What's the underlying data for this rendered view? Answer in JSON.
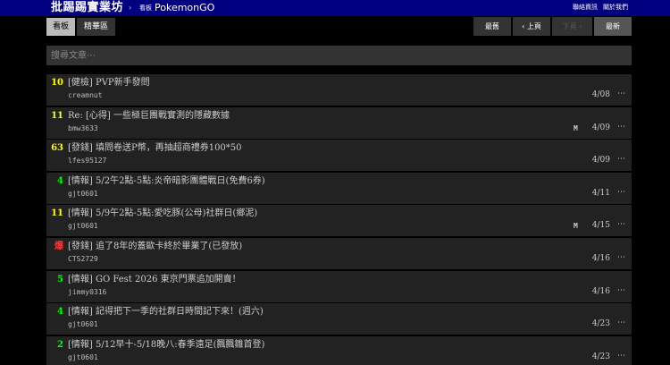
{
  "header": {
    "site_title": "批踢踢實業坊",
    "separator": "›",
    "board_label": "看板",
    "board_name": "PokemonGO",
    "links": [
      "聯絡資訊",
      "關於我們"
    ]
  },
  "tabs": [
    "看板",
    "精華區"
  ],
  "pager": {
    "oldest": "最舊",
    "prev": "‹ 上頁",
    "next": "下頁 ›",
    "newest": "最新"
  },
  "search": {
    "placeholder": "搜尋文章⋯"
  },
  "colors": {
    "topbar": "#000080",
    "push_high": "#ffff00",
    "push_low": "#00ff00",
    "push_hot": "#ff3333"
  },
  "posts": [
    {
      "push": "10",
      "push_color": "yellow",
      "title": "[健檢] PVP新手發問",
      "author": "creamnut",
      "mark": "",
      "date": "4/08",
      "more": "⋯"
    },
    {
      "push": "11",
      "push_color": "yellow",
      "title": "Re: [心得] 一些極巨團戰實測的隱藏數據",
      "author": "bmw3633",
      "mark": "M",
      "date": "4/09",
      "more": "⋯"
    },
    {
      "push": "63",
      "push_color": "yellow",
      "title": "[發錢] 填問卷送P幣，再抽超商禮券100*50",
      "author": "lfes95127",
      "mark": "",
      "date": "4/09",
      "more": "⋯"
    },
    {
      "push": "4",
      "push_color": "green",
      "title": "[情報] 5/2午2點-5點:炎帝暗影團體戰日(免費6券)",
      "author": "gjt0601",
      "mark": "",
      "date": "4/11",
      "more": "⋯"
    },
    {
      "push": "11",
      "push_color": "yellow",
      "title": "[情報] 5/9午2點-5點:愛吃豚(公母)社群日(鄉泥)",
      "author": "gjt0601",
      "mark": "M",
      "date": "4/15",
      "more": "⋯"
    },
    {
      "push": "爆",
      "push_color": "red",
      "title": "[發錢] 追了8年的蓋歐卡終於畢業了(已發放)",
      "author": "CTS2729",
      "mark": "",
      "date": "4/16",
      "more": "⋯"
    },
    {
      "push": "5",
      "push_color": "green",
      "title": "[情報] GO Fest 2026 東京門票追加開賣！",
      "author": "jimmy0316",
      "mark": "",
      "date": "4/16",
      "more": "⋯"
    },
    {
      "push": "4",
      "push_color": "green",
      "title": "[情報] 記得把下一季的社群日時間記下來！(週六)",
      "author": "gjt0601",
      "mark": "",
      "date": "4/23",
      "more": "⋯"
    },
    {
      "push": "2",
      "push_color": "green",
      "title": "[情報] 5/12早十-5/18晚八:春季遠足(飄飄雛首登)",
      "author": "gjt0601",
      "mark": "",
      "date": "4/23",
      "more": "⋯"
    }
  ]
}
